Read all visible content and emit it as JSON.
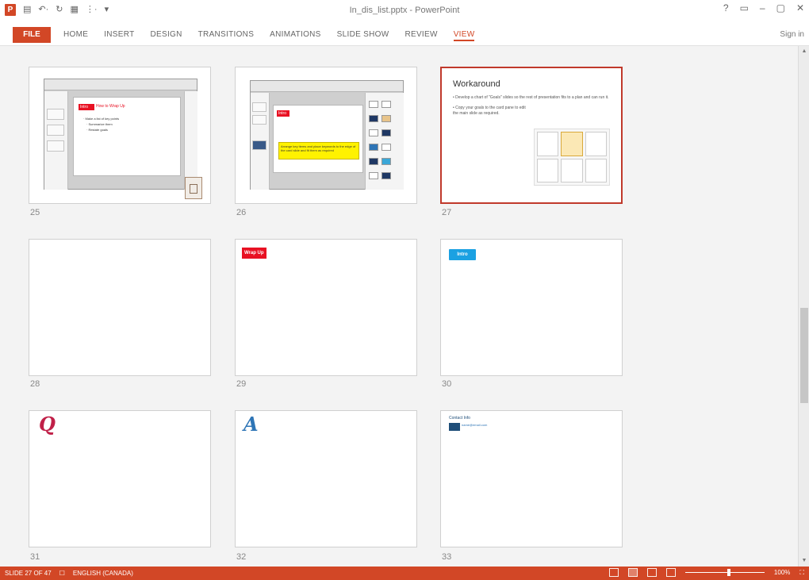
{
  "app": {
    "title": "In_dis_list.pptx - PowerPoint",
    "logo_glyph": "P",
    "quick_access": [
      "▤",
      "↶·",
      "↻",
      "▦",
      "⋮·",
      "▾"
    ],
    "window_controls": [
      "?",
      "▭",
      "–",
      "▢",
      "✕"
    ],
    "signin_label": "Sign in"
  },
  "ribbon": {
    "file_label": "FILE",
    "tabs": [
      {
        "label": "HOME",
        "active": false
      },
      {
        "label": "INSERT",
        "active": false
      },
      {
        "label": "DESIGN",
        "active": false
      },
      {
        "label": "TRANSITIONS",
        "active": false
      },
      {
        "label": "ANIMATIONS",
        "active": false
      },
      {
        "label": "SLIDE SHOW",
        "active": false
      },
      {
        "label": "REVIEW",
        "active": false
      },
      {
        "label": "VIEW",
        "active": true
      }
    ]
  },
  "slides": {
    "s25": {
      "number": "25",
      "badge": "Intro",
      "heading": "How to Wrap Up",
      "bullets": [
        "· Make a list of key points",
        "  · Summarize them",
        "  · Restate goals"
      ]
    },
    "s26": {
      "number": "26",
      "badge": "Intro",
      "yellow_text": "Arrange key items and place keywords to the edge of the card slide and fit them as required"
    },
    "s27": {
      "number": "27",
      "title": "Workaround",
      "bullets": [
        "• Develop a chart of \"Goals\" slides so the rest of presentation fits to a plan and can run it.",
        "• Copy your goals to the card pane to edit the main slide as required."
      ]
    },
    "s28": {
      "number": "28"
    },
    "s29": {
      "number": "29",
      "label": "Wrap Up"
    },
    "s30": {
      "number": "30",
      "label": "Intro"
    },
    "s31": {
      "number": "31",
      "letter": "Q"
    },
    "s32": {
      "number": "32",
      "letter": "A"
    },
    "s33": {
      "number": "33",
      "heading": "Contact Info",
      "info": "name@email.com"
    }
  },
  "status": {
    "slide_info": "SLIDE 27 OF 47",
    "notes_icon": "☐",
    "language": "ENGLISH (CANADA)",
    "zoom": "100%",
    "zoom_fraction": 0.55,
    "fit_label": "⛶"
  },
  "colors": {
    "accent": "#d24726",
    "selected_border": "#c0392b",
    "badge_red": "#e81123",
    "badge_blue": "#1ba1e2",
    "q_letter": "#c02048",
    "a_letter": "#2e75b6"
  }
}
